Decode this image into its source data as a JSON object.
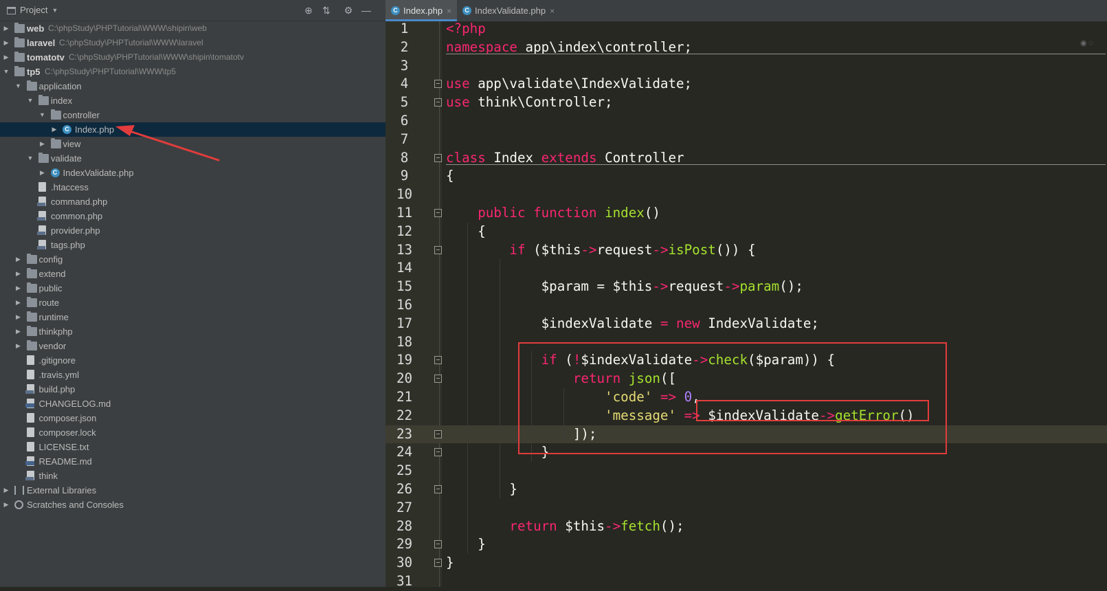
{
  "project_panel": {
    "title": "Project",
    "tools": {
      "locate": "⊕",
      "collapse": "⇅",
      "settings": "⚙",
      "hide": "—"
    },
    "tree": [
      {
        "label": "web",
        "path": "C:\\phpStudy\\PHPTutorial\\WWW\\shipin\\web",
        "depth": 0,
        "arrow": "▶",
        "icon": "folder-icon",
        "bold": true
      },
      {
        "label": "laravel",
        "path": "C:\\phpStudy\\PHPTutorial\\WWW\\laravel",
        "depth": 0,
        "arrow": "▶",
        "icon": "folder-icon",
        "bold": true
      },
      {
        "label": "tomatotv",
        "path": "C:\\phpStudy\\PHPTutorial\\WWW\\shipin\\tomatotv",
        "depth": 0,
        "arrow": "▶",
        "icon": "folder-icon",
        "bold": true
      },
      {
        "label": "tp5",
        "path": "C:\\phpStudy\\PHPTutorial\\WWW\\tp5",
        "depth": 0,
        "arrow": "▼",
        "icon": "folder-icon",
        "bold": true
      },
      {
        "label": "application",
        "depth": 1,
        "arrow": "▼",
        "icon": "folder-icon"
      },
      {
        "label": "index",
        "depth": 2,
        "arrow": "▼",
        "icon": "folder-icon"
      },
      {
        "label": "controller",
        "depth": 3,
        "arrow": "▼",
        "icon": "folder-icon"
      },
      {
        "label": "Index.php",
        "depth": 4,
        "arrow": "▶",
        "icon": "php-class-icon",
        "selected": true
      },
      {
        "label": "view",
        "depth": 3,
        "arrow": "▶",
        "icon": "folder-icon"
      },
      {
        "label": "validate",
        "depth": 2,
        "arrow": "▼",
        "icon": "folder-icon"
      },
      {
        "label": "IndexValidate.php",
        "depth": 3,
        "arrow": "▶",
        "icon": "php-class-icon"
      },
      {
        "label": ".htaccess",
        "depth": 2,
        "icon": "config-file-icon"
      },
      {
        "label": "command.php",
        "depth": 2,
        "icon": "php-file-icon"
      },
      {
        "label": "common.php",
        "depth": 2,
        "icon": "php-file-icon"
      },
      {
        "label": "provider.php",
        "depth": 2,
        "icon": "php-file-icon"
      },
      {
        "label": "tags.php",
        "depth": 2,
        "icon": "php-file-icon"
      },
      {
        "label": "config",
        "depth": 1,
        "arrow": "▶",
        "icon": "folder-icon"
      },
      {
        "label": "extend",
        "depth": 1,
        "arrow": "▶",
        "icon": "folder-icon"
      },
      {
        "label": "public",
        "depth": 1,
        "arrow": "▶",
        "icon": "folder-icon"
      },
      {
        "label": "route",
        "depth": 1,
        "arrow": "▶",
        "icon": "folder-icon"
      },
      {
        "label": "runtime",
        "depth": 1,
        "arrow": "▶",
        "icon": "folder-icon"
      },
      {
        "label": "thinkphp",
        "depth": 1,
        "arrow": "▶",
        "icon": "folder-icon"
      },
      {
        "label": "vendor",
        "depth": 1,
        "arrow": "▶",
        "icon": "folder-icon"
      },
      {
        "label": ".gitignore",
        "depth": 1,
        "icon": "text-file-icon"
      },
      {
        "label": ".travis.yml",
        "depth": 1,
        "icon": "yml-file-icon"
      },
      {
        "label": "build.php",
        "depth": 1,
        "icon": "php-file-icon"
      },
      {
        "label": "CHANGELOG.md",
        "depth": 1,
        "icon": "md-file-icon"
      },
      {
        "label": "composer.json",
        "depth": 1,
        "icon": "config-file-icon"
      },
      {
        "label": "composer.lock",
        "depth": 1,
        "icon": "config-file-icon"
      },
      {
        "label": "LICENSE.txt",
        "depth": 1,
        "icon": "text-file-icon"
      },
      {
        "label": "README.md",
        "depth": 1,
        "icon": "md-file-icon"
      },
      {
        "label": "think",
        "depth": 1,
        "icon": "php-file-icon"
      },
      {
        "label": "External Libraries",
        "depth": 0,
        "arrow": "▶",
        "icon": "libraries-icon"
      },
      {
        "label": "Scratches and Consoles",
        "depth": 0,
        "arrow": "▶",
        "icon": "scratches-icon"
      }
    ]
  },
  "editor": {
    "tabs": [
      {
        "label": "Index.php",
        "close": "×",
        "active": true,
        "icon": "php-class-icon"
      },
      {
        "label": "IndexValidate.php",
        "close": "×",
        "active": false,
        "icon": "php-class-icon"
      }
    ],
    "current_line": 23,
    "lines": [
      {
        "n": "1",
        "tokens": [
          [
            "kw",
            "<?php"
          ]
        ]
      },
      {
        "n": "2",
        "tokens": [
          [
            "kw",
            "namespace"
          ],
          [
            "",
            " app\\index\\controller;"
          ]
        ]
      },
      {
        "n": "3",
        "tokens": []
      },
      {
        "n": "4",
        "fold": true,
        "tokens": [
          [
            "kw",
            "use"
          ],
          [
            "",
            " app\\validate\\IndexValidate;"
          ]
        ]
      },
      {
        "n": "5",
        "fold": true,
        "tokens": [
          [
            "kw",
            "use"
          ],
          [
            "",
            " think\\Controller;"
          ]
        ]
      },
      {
        "n": "6",
        "tokens": []
      },
      {
        "n": "7",
        "tokens": []
      },
      {
        "n": "8",
        "fold": true,
        "tokens": [
          [
            "kw",
            "class"
          ],
          [
            "",
            " Index "
          ],
          [
            "kw",
            "extends"
          ],
          [
            "",
            " Controller"
          ]
        ]
      },
      {
        "n": "9",
        "tokens": [
          [
            "",
            "{"
          ]
        ]
      },
      {
        "n": "10",
        "tokens": []
      },
      {
        "n": "11",
        "fold": true,
        "tokens": [
          [
            "",
            "    "
          ],
          [
            "kw",
            "public"
          ],
          [
            "",
            " "
          ],
          [
            "kw",
            "function"
          ],
          [
            "",
            " "
          ],
          [
            "fn",
            "index"
          ],
          [
            "",
            "()"
          ]
        ]
      },
      {
        "n": "12",
        "tokens": [
          [
            "",
            "    {"
          ]
        ]
      },
      {
        "n": "13",
        "fold": true,
        "tokens": [
          [
            "",
            "        "
          ],
          [
            "kw",
            "if"
          ],
          [
            "",
            " ($this"
          ],
          [
            "kw",
            "->"
          ],
          [
            "",
            "request"
          ],
          [
            "kw",
            "->"
          ],
          [
            "fn",
            "isPost"
          ],
          [
            "",
            "()) {"
          ]
        ]
      },
      {
        "n": "14",
        "tokens": []
      },
      {
        "n": "15",
        "tokens": [
          [
            "",
            "            $param = $this"
          ],
          [
            "kw",
            "->"
          ],
          [
            "",
            "request"
          ],
          [
            "kw",
            "->"
          ],
          [
            "fn",
            "param"
          ],
          [
            "",
            "();"
          ]
        ]
      },
      {
        "n": "16",
        "tokens": []
      },
      {
        "n": "17",
        "tokens": [
          [
            "",
            "            $indexValidate "
          ],
          [
            "kw",
            "="
          ],
          [
            "",
            " "
          ],
          [
            "kw",
            "new"
          ],
          [
            "",
            " IndexValidate;"
          ]
        ]
      },
      {
        "n": "18",
        "tokens": []
      },
      {
        "n": "19",
        "fold": true,
        "tokens": [
          [
            "",
            "            "
          ],
          [
            "kw",
            "if"
          ],
          [
            "",
            " ("
          ],
          [
            "kw",
            "!"
          ],
          [
            "",
            "$indexValidate"
          ],
          [
            "kw",
            "->"
          ],
          [
            "fn",
            "check"
          ],
          [
            "",
            "($param)) {"
          ]
        ]
      },
      {
        "n": "20",
        "fold": true,
        "tokens": [
          [
            "",
            "                "
          ],
          [
            "kw",
            "return"
          ],
          [
            "",
            " "
          ],
          [
            "fn",
            "json"
          ],
          [
            "",
            "(["
          ]
        ]
      },
      {
        "n": "21",
        "tokens": [
          [
            "",
            "                    "
          ],
          [
            "str",
            "'code'"
          ],
          [
            "",
            " "
          ],
          [
            "kw",
            "=>"
          ],
          [
            "",
            " "
          ],
          [
            "num",
            "0"
          ],
          [
            "",
            ","
          ]
        ]
      },
      {
        "n": "22",
        "tokens": [
          [
            "",
            "                    "
          ],
          [
            "str",
            "'message'"
          ],
          [
            "",
            " "
          ],
          [
            "kw",
            "=>"
          ],
          [
            "",
            " $indexValidate"
          ],
          [
            "kw",
            "->"
          ],
          [
            "fn",
            "getError"
          ],
          [
            "",
            "()"
          ]
        ]
      },
      {
        "n": "23",
        "fold": true,
        "tokens": [
          [
            "",
            "                ]);"
          ]
        ]
      },
      {
        "n": "24",
        "fold": true,
        "tokens": [
          [
            "",
            "            }"
          ]
        ]
      },
      {
        "n": "25",
        "tokens": []
      },
      {
        "n": "26",
        "fold": true,
        "tokens": [
          [
            "",
            "        }"
          ]
        ]
      },
      {
        "n": "27",
        "tokens": []
      },
      {
        "n": "28",
        "tokens": [
          [
            "",
            "        "
          ],
          [
            "kw",
            "return"
          ],
          [
            "",
            " $this"
          ],
          [
            "kw",
            "->"
          ],
          [
            "fn",
            "fetch"
          ],
          [
            "",
            "();"
          ]
        ]
      },
      {
        "n": "29",
        "fold": true,
        "tokens": [
          [
            "",
            "    }"
          ]
        ]
      },
      {
        "n": "30",
        "fold": true,
        "tokens": [
          [
            "",
            "}"
          ]
        ]
      },
      {
        "n": "31",
        "tokens": []
      }
    ]
  },
  "colors": {
    "annotation": "#e23c3c",
    "keyword": "#f92672",
    "function": "#a6e22e",
    "string": "#e6db74",
    "number": "#ae81ff"
  }
}
